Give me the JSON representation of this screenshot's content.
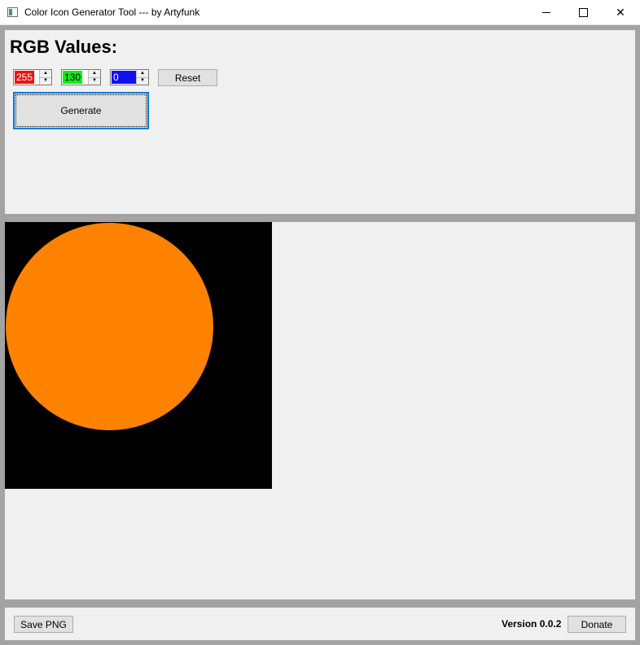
{
  "window": {
    "title": "Color Icon Generator Tool --- by Artyfunk",
    "minimize_glyph": "",
    "close_glyph": "✕"
  },
  "controls": {
    "heading": "RGB Values:",
    "red": {
      "value": "255",
      "bg_color": "#ee1111"
    },
    "green": {
      "value": "130",
      "bg_color": "#11ee11"
    },
    "blue": {
      "value": "0",
      "bg_color": "#1111ee"
    },
    "spin_up_glyph": "▲",
    "spin_down_glyph": "▼",
    "reset_label": "Reset",
    "generate_label": "Generate"
  },
  "preview": {
    "background_color": "#000000",
    "circle_color": "#ff8200"
  },
  "footer": {
    "save_label": "Save PNG",
    "version_text": "Version 0.0.2",
    "donate_label": "Donate"
  }
}
